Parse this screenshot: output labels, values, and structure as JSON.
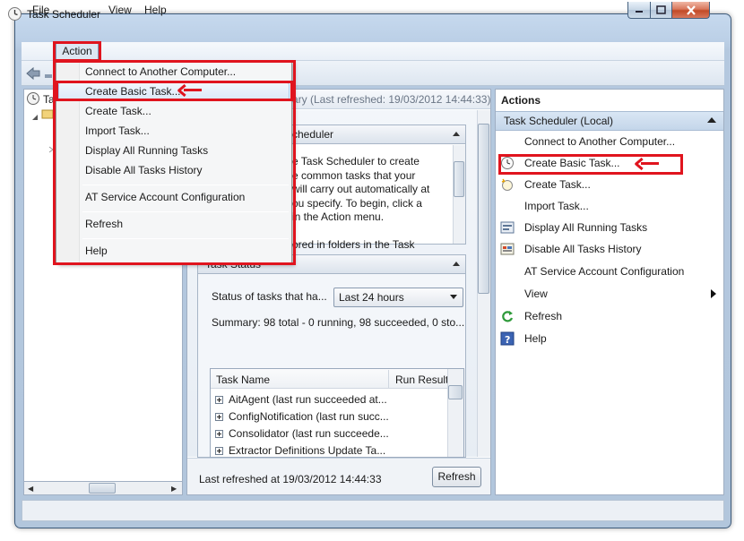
{
  "window": {
    "title": "Task Scheduler"
  },
  "menubar": {
    "file": "File",
    "action": "Action",
    "view": "View",
    "help": "Help"
  },
  "action_menu": {
    "items": [
      "Connect to Another Computer...",
      "Create Basic Task...",
      "Create Task...",
      "Import Task...",
      "Display All Running Tasks",
      "Disable All Tasks History",
      "AT Service Account Configuration",
      "Refresh",
      "Help"
    ],
    "highlighted": "Create Basic Task..."
  },
  "tree": {
    "root_label": "Ta"
  },
  "center": {
    "header": "ary (Last refreshed: 19/03/2012 14:44:33)",
    "overview_title": "cheduler",
    "overview_text": "e Task Scheduler to create\ne common tasks that your\nwill carry out automatically at\nou specify. To begin, click a\nin the Action menu.\n\nored in folders in the Task",
    "status_title": "Task Status",
    "status_label": "Status of tasks that ha...",
    "status_select": "Last 24 hours",
    "summary": "Summary: 98 total - 0 running, 98 succeeded, 0 sto...",
    "table": {
      "col_name": "Task Name",
      "col_result": "Run Result",
      "rows": [
        "AitAgent (last run succeeded at...",
        "ConfigNotification (last run succ...",
        "Consolidator (last run succeede...",
        "Extractor Definitions Update Ta..."
      ]
    },
    "footer_text": "Last refreshed at 19/03/2012 14:44:33",
    "refresh_button": "Refresh"
  },
  "actions": {
    "title": "Actions",
    "group": "Task Scheduler (Local)",
    "items": [
      {
        "label": "Connect to Another Computer...",
        "icon": "none"
      },
      {
        "label": "Create Basic Task...",
        "icon": "clock-icon"
      },
      {
        "label": "Create Task...",
        "icon": "new-task-icon"
      },
      {
        "label": "Import Task...",
        "icon": "none"
      },
      {
        "label": "Display All Running Tasks",
        "icon": "running-tasks-icon"
      },
      {
        "label": "Disable All Tasks History",
        "icon": "history-icon"
      },
      {
        "label": "AT Service Account Configuration",
        "icon": "none"
      },
      {
        "label": "View",
        "icon": "none"
      },
      {
        "label": "Refresh",
        "icon": "refresh-icon"
      },
      {
        "label": "Help",
        "icon": "help-icon"
      }
    ]
  },
  "colors": {
    "annotation_red": "#e0141e",
    "menu_highlight": "#dce9f8",
    "window_frame": "#bcd0e7"
  }
}
